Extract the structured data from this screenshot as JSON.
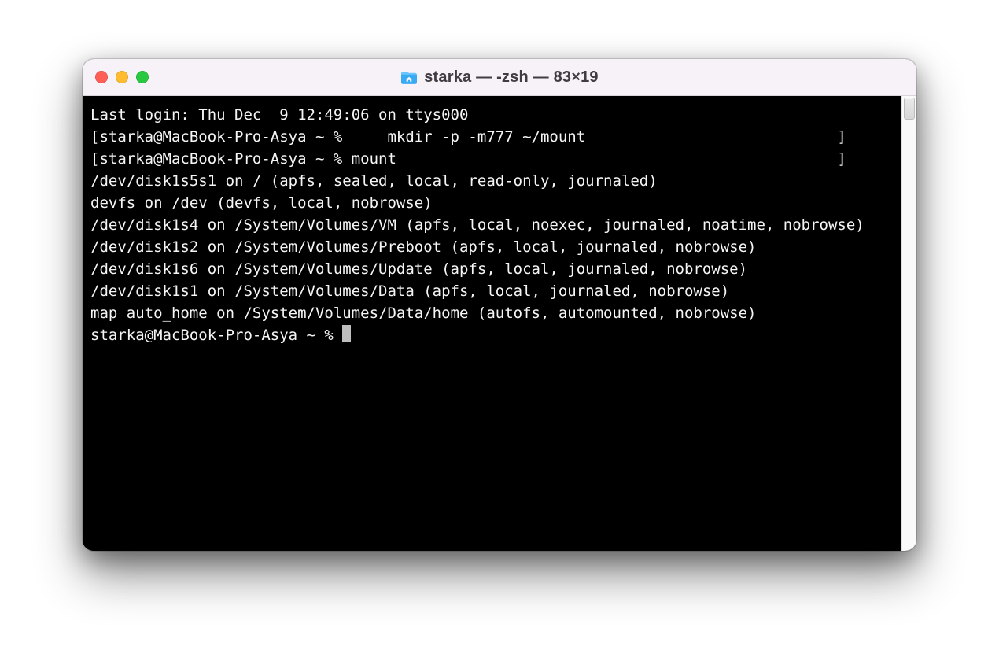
{
  "window": {
    "title": "starka — -zsh — 83×19"
  },
  "colors": {
    "close": "#ff5f57",
    "min": "#febc2e",
    "zoom": "#28c840",
    "titlebar_bg": "#f6f2f7",
    "terminal_bg": "#000000",
    "terminal_fg": "#f5f5f5"
  },
  "terminal": {
    "prompt_user": "starka",
    "prompt_host": "MacBook-Pro-Asya",
    "prompt_path": "~",
    "prompt_symbol": "%",
    "lines": [
      "Last login: Thu Dec  9 12:49:06 on ttys000",
      "[starka@MacBook-Pro-Asya ~ %     mkdir -p -m777 ~/mount                            ]",
      "[starka@MacBook-Pro-Asya ~ % mount                                                 ]",
      "/dev/disk1s5s1 on / (apfs, sealed, local, read-only, journaled)",
      "devfs on /dev (devfs, local, nobrowse)",
      "/dev/disk1s4 on /System/Volumes/VM (apfs, local, noexec, journaled, noatime, nobrowse)",
      "/dev/disk1s2 on /System/Volumes/Preboot (apfs, local, journaled, nobrowse)",
      "/dev/disk1s6 on /System/Volumes/Update (apfs, local, journaled, nobrowse)",
      "/dev/disk1s1 on /System/Volumes/Data (apfs, local, journaled, nobrowse)",
      "map auto_home on /System/Volumes/Data/home (autofs, automounted, nobrowse)"
    ],
    "current_prompt": "starka@MacBook-Pro-Asya ~ % "
  }
}
